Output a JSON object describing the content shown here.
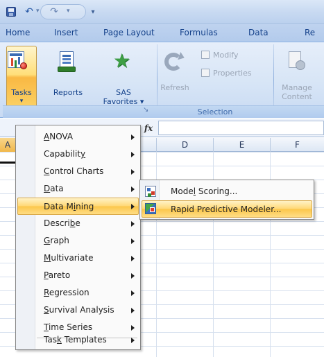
{
  "titlebar": {
    "save_icon": "save-icon",
    "undo_icon": "undo-icon",
    "undo_glyph": "↶",
    "redo_glyph": "↷",
    "dropdown_glyph": "▾",
    "customize_glyph": "▾"
  },
  "tabs": [
    "Home",
    "Insert",
    "Page Layout",
    "Formulas",
    "Data",
    "Re"
  ],
  "ribbon": {
    "tasks_label": "Tasks",
    "tasks_arrow": "▾",
    "reports_label": "Reports",
    "sas_label": "SAS",
    "favorites_label": "Favorites ▾",
    "refresh_label": "Refresh",
    "modify_label": "Modify",
    "properties_label": "Properties",
    "selection_label": "Selection",
    "manage_label": "Manage",
    "content_label": "Content",
    "dialog_launcher": "↘"
  },
  "formula_bar": {
    "fx_label": "fx"
  },
  "columns": [
    "A",
    "D",
    "E",
    "F"
  ],
  "tasks_menu": {
    "items": [
      {
        "pre": "",
        "u": "A",
        "post": "NOVA"
      },
      {
        "pre": "Capabilit",
        "u": "y",
        "post": ""
      },
      {
        "pre": "",
        "u": "C",
        "post": "ontrol Charts"
      },
      {
        "pre": "",
        "u": "D",
        "post": "ata"
      },
      {
        "pre": "Data M",
        "u": "i",
        "post": "ning"
      },
      {
        "pre": "Descri",
        "u": "b",
        "post": "e"
      },
      {
        "pre": "",
        "u": "G",
        "post": "raph"
      },
      {
        "pre": "",
        "u": "M",
        "post": "ultivariate"
      },
      {
        "pre": "",
        "u": "P",
        "post": "areto"
      },
      {
        "pre": "",
        "u": "R",
        "post": "egression"
      },
      {
        "pre": "",
        "u": "S",
        "post": "urvival Analysis"
      },
      {
        "pre": "",
        "u": "T",
        "post": "ime Series"
      },
      {
        "pre": "Tas",
        "u": "k",
        "post": " Templates"
      }
    ]
  },
  "data_mining_submenu": {
    "items": [
      {
        "pre": "Mode",
        "u": "l",
        "post": " Scoring...",
        "icon": "model-scoring-icon"
      },
      {
        "pre": "Rapid Predictive Modeler...",
        "u": "",
        "post": "",
        "icon": "rapid-predictive-modeler-icon"
      }
    ]
  }
}
